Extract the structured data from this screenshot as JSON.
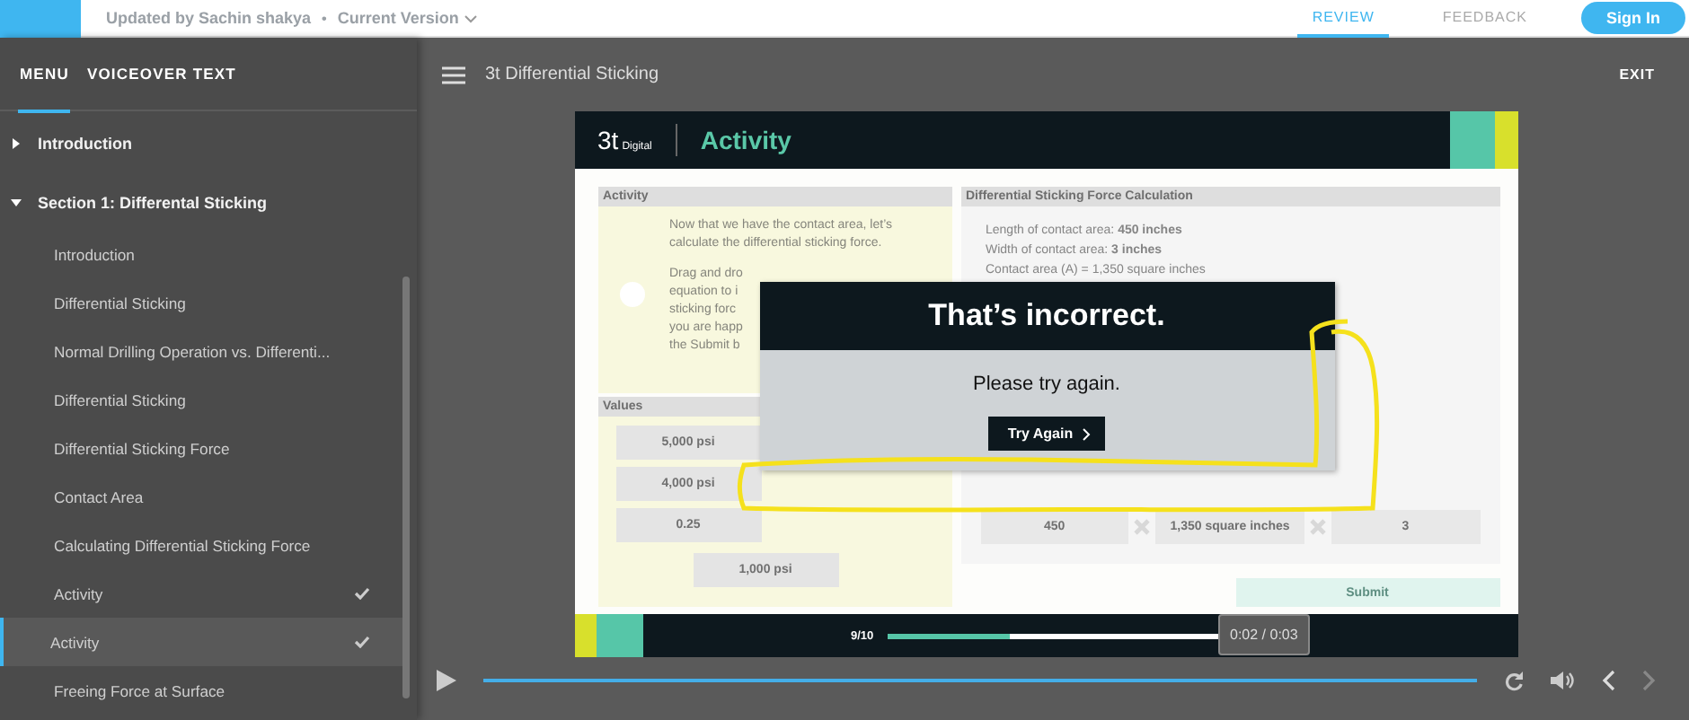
{
  "header": {
    "updated_by": "Updated by Sachin shakya",
    "separator": "•",
    "version": "Current Version",
    "nav": [
      {
        "label": "REVIEW",
        "selected": true
      },
      {
        "label": "FEEDBACK",
        "selected": false
      }
    ],
    "sign_in": "Sign In"
  },
  "sidebar": {
    "tabs": [
      {
        "label": "MENU",
        "selected": true
      },
      {
        "label": "VOICEOVER TEXT",
        "selected": false
      }
    ],
    "items": [
      {
        "label": "Introduction",
        "expanded": false
      },
      {
        "label": "Section 1: Differental Sticking",
        "expanded": true,
        "children": [
          {
            "label": "Introduction",
            "completed": false,
            "selected": false
          },
          {
            "label": "Differential Sticking",
            "completed": false,
            "selected": false
          },
          {
            "label": "Normal Drilling Operation vs. Differenti...",
            "completed": false,
            "selected": false
          },
          {
            "label": "Differential Sticking",
            "completed": false,
            "selected": false
          },
          {
            "label": "Differential Sticking Force",
            "completed": false,
            "selected": false
          },
          {
            "label": "Contact Area",
            "completed": false,
            "selected": false
          },
          {
            "label": "Calculating Differential Sticking Force",
            "completed": false,
            "selected": false
          },
          {
            "label": "Activity",
            "completed": true,
            "selected": false
          },
          {
            "label": "Activity",
            "completed": true,
            "selected": true
          },
          {
            "label": "Freeing Force at Surface",
            "completed": false,
            "selected": false
          }
        ]
      }
    ]
  },
  "player": {
    "title": "3t Differential Sticking",
    "exit": "EXIT",
    "slide": {
      "logo": "3t",
      "logo_sub": "Digital",
      "title": "Activity",
      "activity_panel": {
        "heading": "Activity",
        "intro": "Now that we have the contact area, let’s calculate the differential sticking force.",
        "instruction_lines": [
          "Drag and dro",
          "equation to i",
          "sticking forc",
          "you are happ",
          "the Submit b"
        ]
      },
      "values_panel": {
        "heading": "Values",
        "values": [
          "5,000 psi",
          "4,000 psi",
          "0.25",
          "1,000 psi"
        ]
      },
      "calc_panel": {
        "heading": "Differential Sticking Force Calculation",
        "facts": [
          "Length of contact area: **450 inches**",
          "Width of contact area: **3 inches**",
          "Contact area (A) = 1,350 square inches"
        ],
        "slots": [
          "450",
          "1,350 square inches",
          "3"
        ],
        "submit": "Submit"
      },
      "feedback": {
        "title": "That’s incorrect.",
        "message": "Please try again.",
        "button": "Try Again"
      },
      "progress": {
        "label": "9/10",
        "level": 0.35
      }
    },
    "controls": {
      "seek": {
        "level": 1
      },
      "tooltip": "0:02 / 0:03",
      "next_disabled": true
    }
  }
}
